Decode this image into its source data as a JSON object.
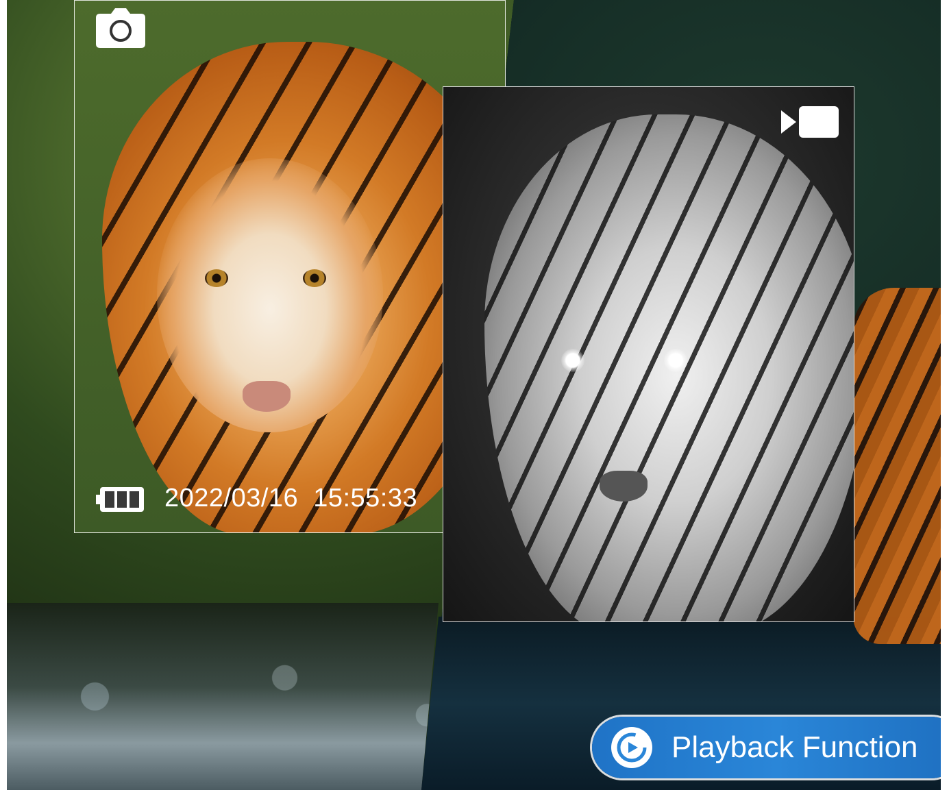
{
  "overlay": {
    "date": "2022/03/16",
    "time": "15:55:33"
  },
  "icons": {
    "photo_mode": "camera-icon",
    "video_mode": "video-camera-icon",
    "battery": "battery-full-icon",
    "playback": "playback-icon"
  },
  "badge": {
    "label": "Playback Function",
    "color": "#2a86d8"
  },
  "colors": {
    "overlay_text": "#ffffff",
    "frame_border": "#ffffff"
  }
}
